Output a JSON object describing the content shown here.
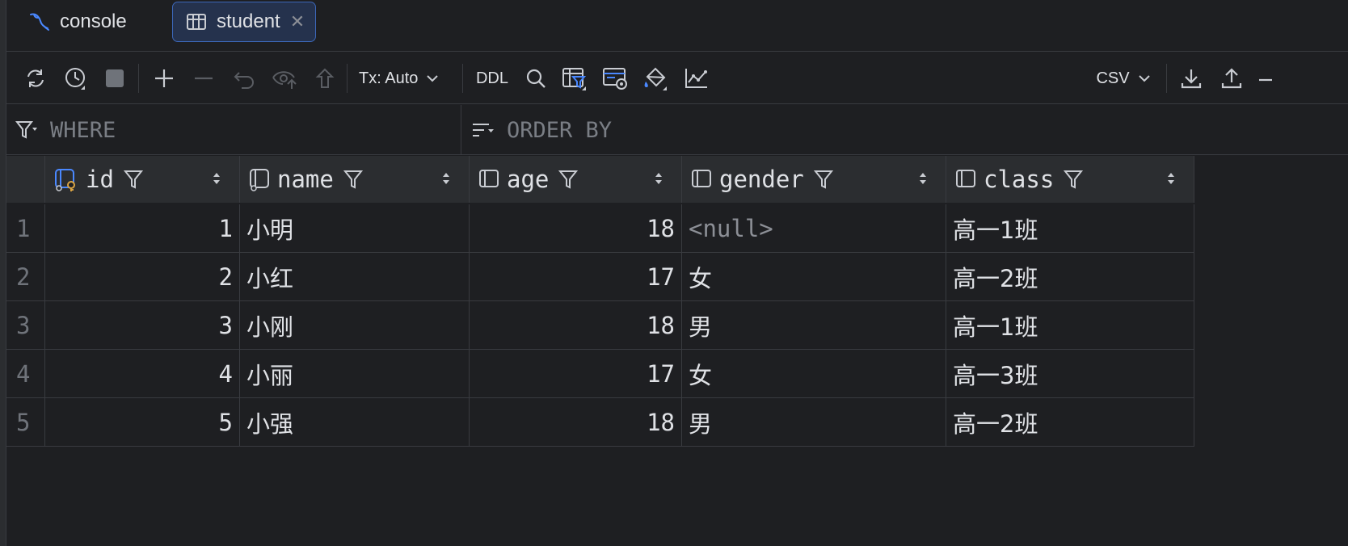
{
  "tabs": [
    {
      "label": "console",
      "icon": "mysql-dolphin-icon"
    },
    {
      "label": "student",
      "icon": "table-icon",
      "close": "✕"
    }
  ],
  "toolbar": {
    "tx_mode": "Tx: Auto",
    "ddl_label": "DDL",
    "export_format": "CSV"
  },
  "filters": {
    "where_placeholder": "WHERE",
    "order_by_placeholder": "ORDER BY"
  },
  "table": {
    "columns": [
      {
        "name": "id",
        "key": true
      },
      {
        "name": "name"
      },
      {
        "name": "age"
      },
      {
        "name": "gender"
      },
      {
        "name": "class"
      }
    ],
    "rows": [
      {
        "n": "1",
        "id": "1",
        "name": "小明",
        "age": "18",
        "gender": "<null>",
        "class": "高一1班"
      },
      {
        "n": "2",
        "id": "2",
        "name": "小红",
        "age": "17",
        "gender": "女",
        "class": "高一2班"
      },
      {
        "n": "3",
        "id": "3",
        "name": "小刚",
        "age": "18",
        "gender": "男",
        "class": "高一1班"
      },
      {
        "n": "4",
        "id": "4",
        "name": "小丽",
        "age": "17",
        "gender": "女",
        "class": "高一3班"
      },
      {
        "n": "5",
        "id": "5",
        "name": "小强",
        "age": "18",
        "gender": "男",
        "class": "高一2班"
      }
    ]
  },
  "colors": {
    "background": "#1e1f22",
    "header": "#2b2d30",
    "active_tab": "#25324d",
    "active_tab_border": "#3c67b8",
    "accent_blue": "#4a88ff",
    "accent_orange": "#d9a343"
  }
}
